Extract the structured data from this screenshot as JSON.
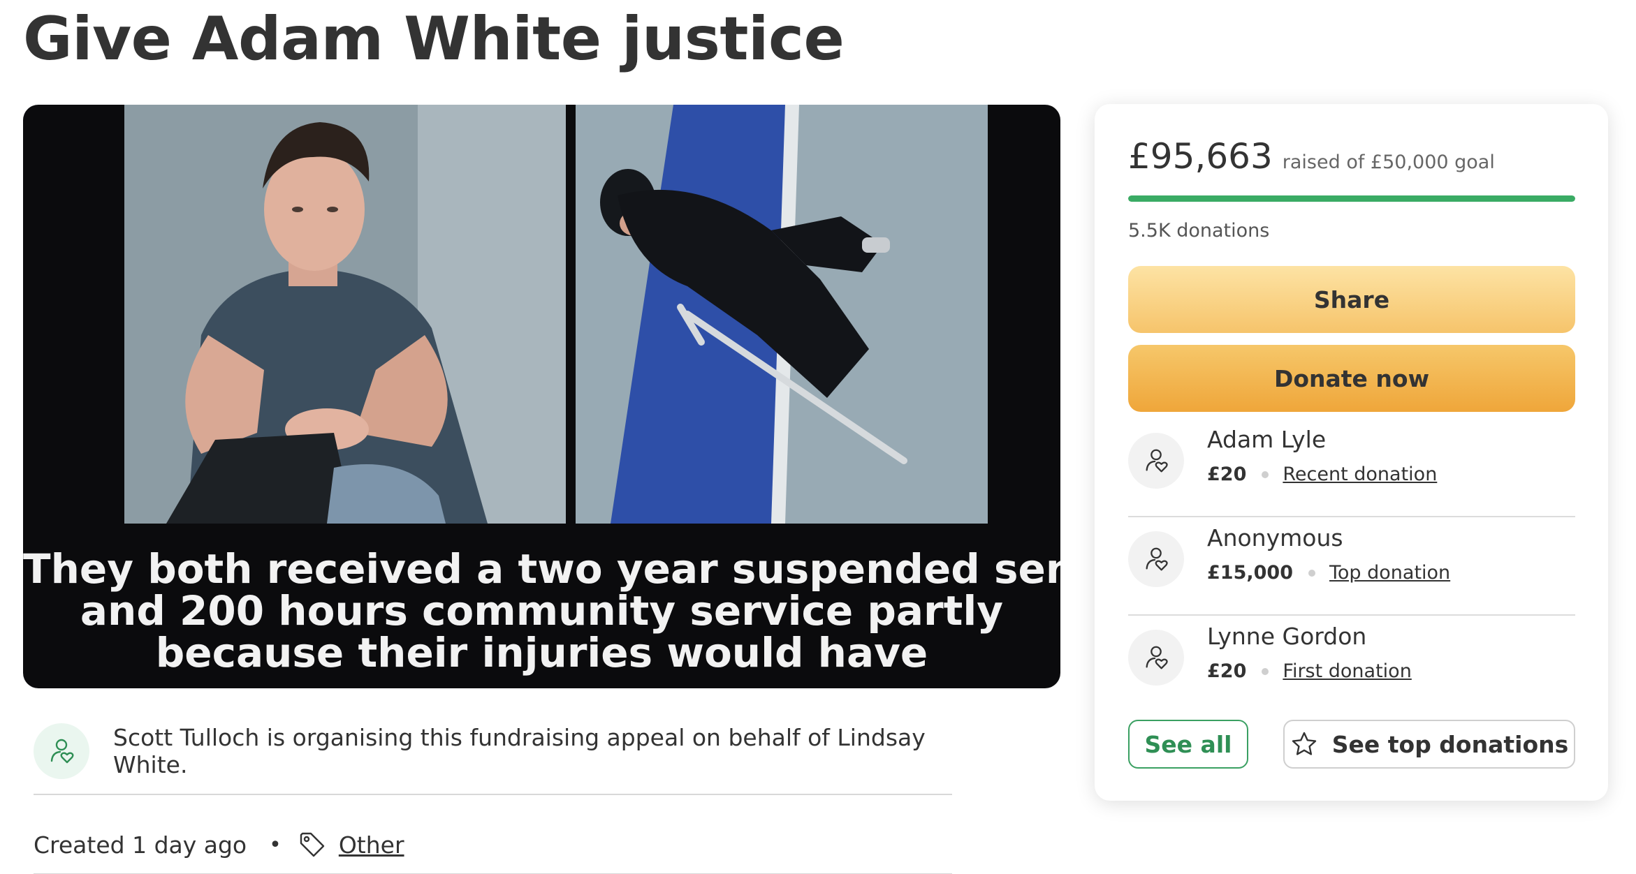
{
  "page": {
    "title": "Give Adam White justice"
  },
  "hero": {
    "caption_lines": [
      "They both received a two year suspended sentence",
      "and 200 hours community service partly",
      "because their injuries would have"
    ]
  },
  "organizer": {
    "icon": "user-heart-icon",
    "text": "Scott Tulloch is organising this fundraising appeal on behalf of Lindsay White."
  },
  "meta": {
    "created": "Created 1 day ago",
    "separator": "•",
    "tag_icon": "tag-icon",
    "category": "Other"
  },
  "donation_card": {
    "raised_amount": "£95,663",
    "goal_text": "raised of £50,000 goal",
    "progress_fraction": 1.0,
    "donations_count": "5.5K donations",
    "share_label": "Share",
    "donate_label": "Donate now",
    "donors": [
      {
        "name": "Adam Lyle",
        "amount": "£20",
        "label": "Recent donation"
      },
      {
        "name": "Anonymous",
        "amount": "£15,000",
        "label": "Top donation"
      },
      {
        "name": "Lynne Gordon",
        "amount": "£20",
        "label": "First donation"
      }
    ],
    "see_all_label": "See all",
    "see_top_label": "See top donations",
    "see_top_icon": "star-icon"
  },
  "colors": {
    "accent_green": "#3aab64",
    "share_button": "#f6c46b",
    "donate_button": "#efa63a",
    "text": "#333333"
  }
}
